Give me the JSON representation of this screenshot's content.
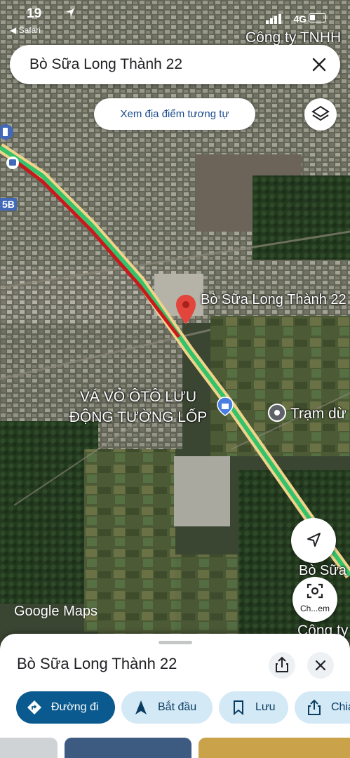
{
  "status_bar": {
    "time": "19",
    "back_label": "◀ Safari",
    "network": "4G"
  },
  "search": {
    "query": "Bò Sữa Long Thành 22"
  },
  "similar_chip": {
    "label": "Xem địa điểm tương tự"
  },
  "map": {
    "labels": {
      "company_top": "Công ty TNHH",
      "place_name": "Bò Sữa Long Thành 22",
      "tire_shop": "VÁ VỎ ÔTÔ LƯU ĐỘNG TƯỜNG LỐP",
      "station": "Trạm dừ",
      "bo_sua_right": "Bò Sữa",
      "company_right": "Công ty",
      "route_badge": "5B"
    },
    "logo_google": "Google",
    "logo_maps": "Maps",
    "lens_label": "Ch...em"
  },
  "sheet": {
    "title": "Bò Sữa Long Thành 22",
    "actions": [
      {
        "label": "Đường đi",
        "icon": "directions-icon"
      },
      {
        "label": "Bắt đầu",
        "icon": "navigation-arrow-icon"
      },
      {
        "label": "Lưu",
        "icon": "bookmark-icon"
      },
      {
        "label": "Chia",
        "icon": "share-icon"
      }
    ]
  },
  "colors": {
    "primary_action": "#0b5a8f",
    "secondary_action": "#d3e9f6",
    "pin_red": "#e2453c",
    "traffic_green": "#34c26b",
    "traffic_red": "#c8191c"
  }
}
